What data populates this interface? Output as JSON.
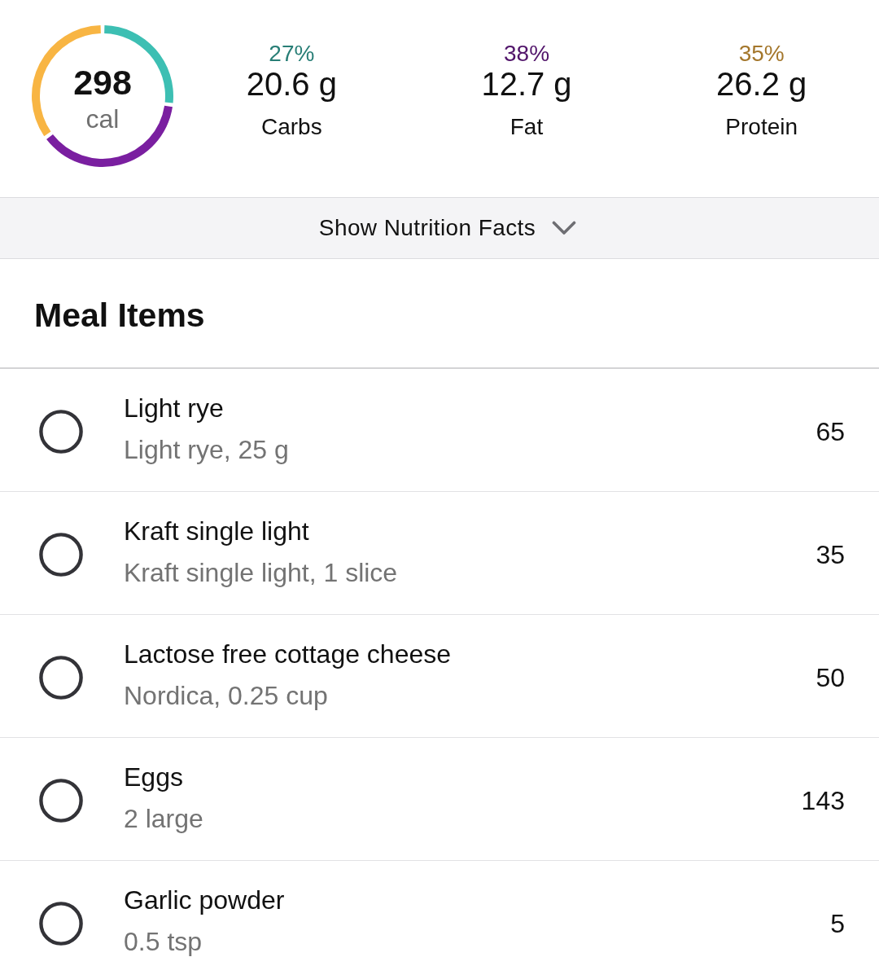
{
  "summary": {
    "calories": {
      "value": "298",
      "unit": "cal"
    },
    "ring": {
      "chart_data": {
        "type": "donut",
        "values": [
          27,
          38,
          35
        ]
      }
    },
    "macros": [
      {
        "percent": "27%",
        "amount": "20.6 g",
        "label": "Carbs",
        "color": "#3dbfb3"
      },
      {
        "percent": "38%",
        "amount": "12.7 g",
        "label": "Fat",
        "color": "#7a1fa0"
      },
      {
        "percent": "35%",
        "amount": "26.2 g",
        "label": "Protein",
        "color": "#f8b543"
      }
    ]
  },
  "nutrition_toggle": {
    "label": "Show Nutrition Facts",
    "expanded": false
  },
  "meal_items": {
    "title": "Meal Items",
    "items": [
      {
        "name": "Light rye",
        "detail": "Light rye, 25 g",
        "calories": "65",
        "checked": false
      },
      {
        "name": "Kraft single light",
        "detail": "Kraft single light, 1 slice",
        "calories": "35",
        "checked": false
      },
      {
        "name": "Lactose free cottage cheese",
        "detail": "Nordica, 0.25 cup",
        "calories": "50",
        "checked": false
      },
      {
        "name": "Eggs",
        "detail": "2 large",
        "calories": "143",
        "checked": false
      },
      {
        "name": "Garlic powder",
        "detail": "0.5 tsp",
        "calories": "5",
        "checked": false
      }
    ]
  }
}
